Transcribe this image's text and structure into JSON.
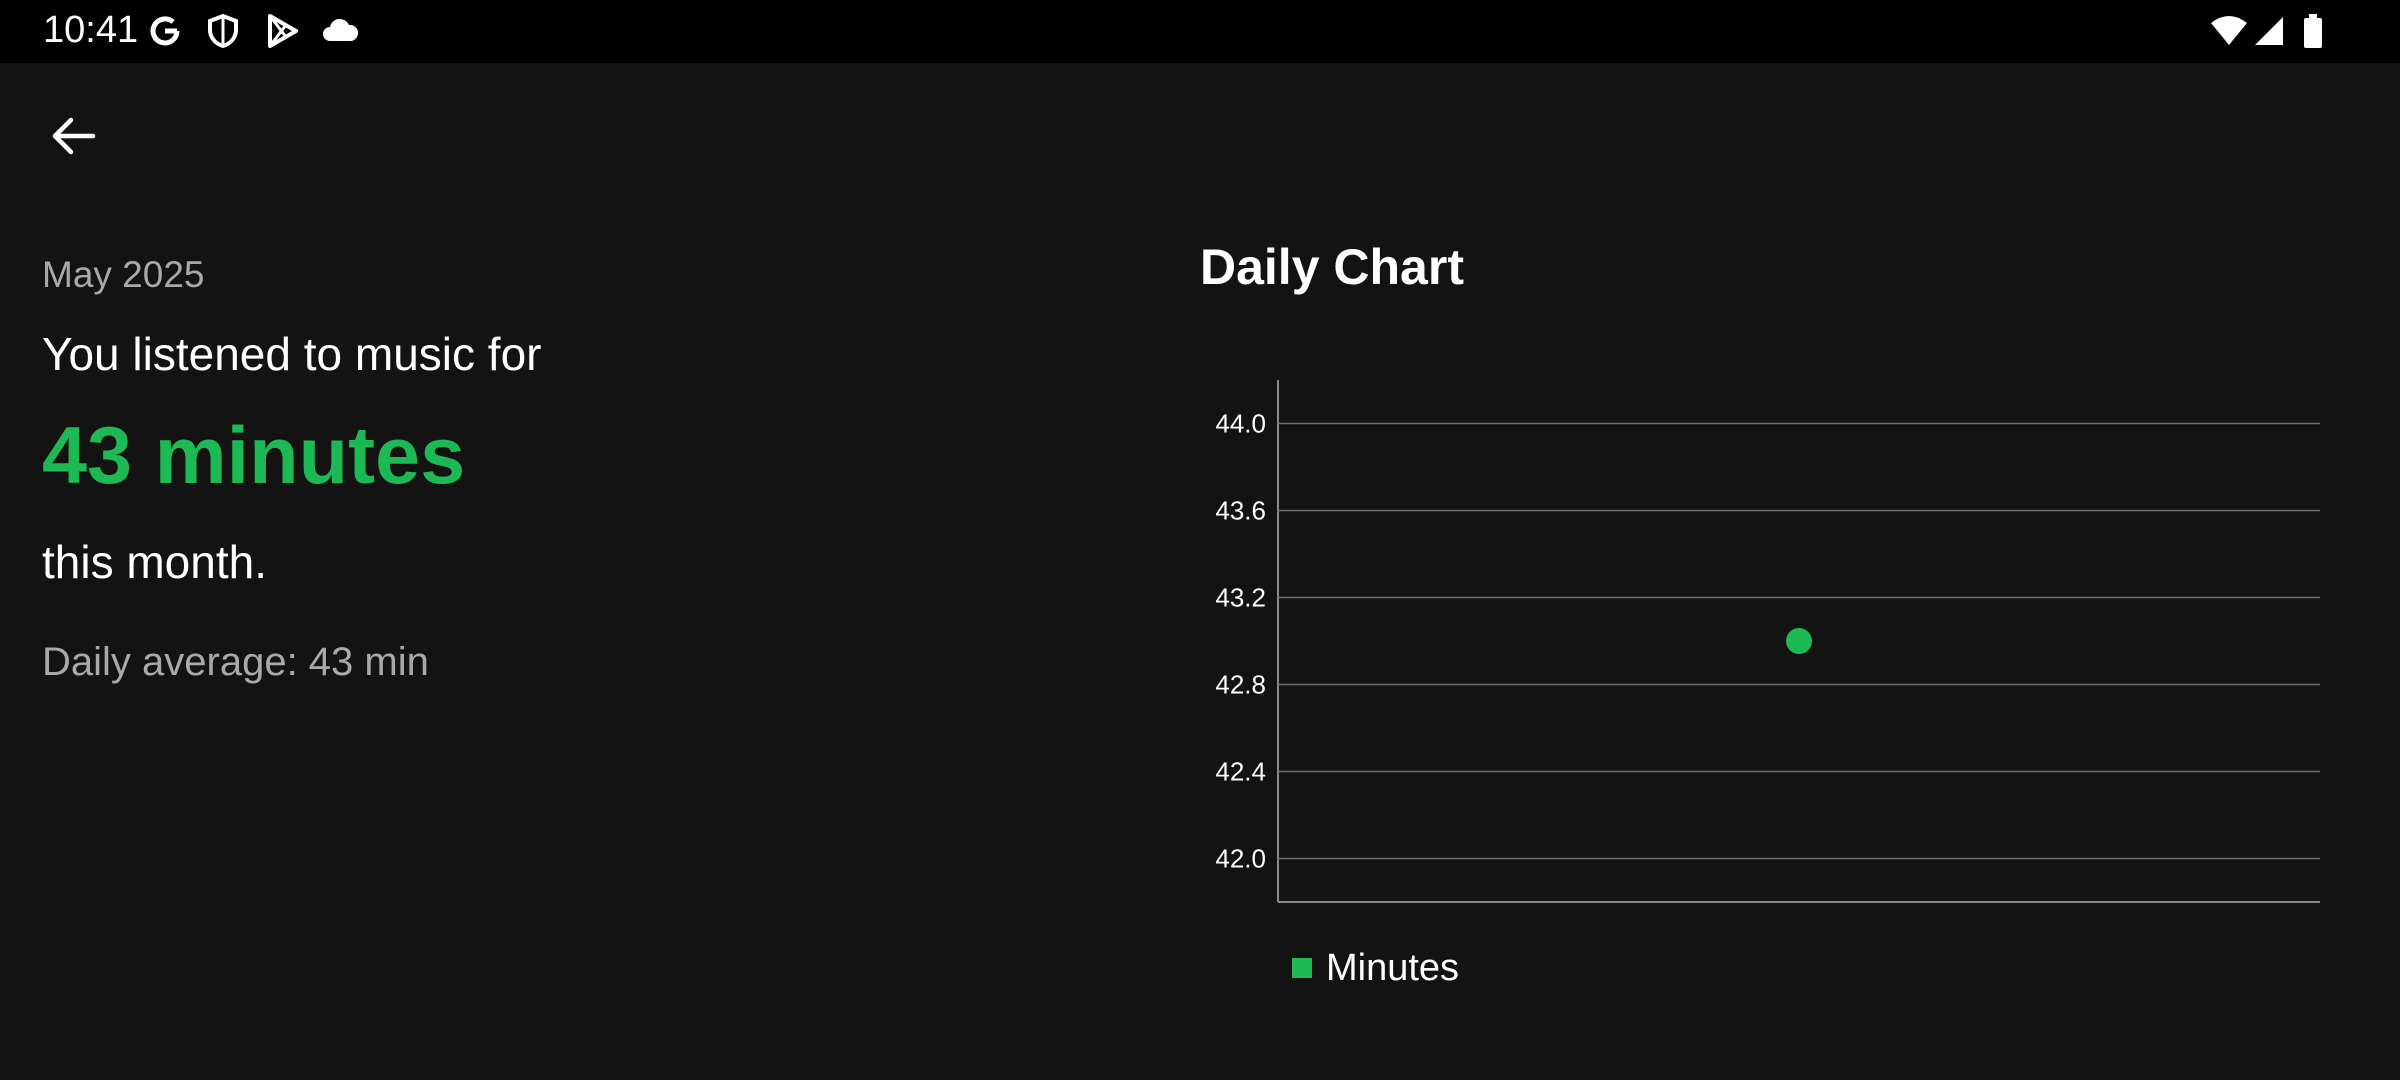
{
  "status_bar": {
    "time": "10:41",
    "left_icons": [
      "google-icon",
      "shield-icon",
      "play-store-icon",
      "cloud-icon"
    ],
    "right_icons": [
      "wifi-icon",
      "signal-icon",
      "battery-icon"
    ]
  },
  "toolbar": {
    "back_icon": "arrow-back-icon"
  },
  "summary": {
    "period": "May 2025",
    "intro": "You listened to music for",
    "total": "43 minutes",
    "outro": "this month.",
    "daily_average": "Daily average: 43 min"
  },
  "colors": {
    "accent": "#1DB954",
    "background": "#131313",
    "secondary_text": "#a9a9a9"
  },
  "chart": {
    "title": "Daily Chart",
    "legend": "Minutes"
  },
  "chart_data": {
    "type": "scatter",
    "title": "Daily Chart",
    "x": [
      1
    ],
    "series": [
      {
        "name": "Minutes",
        "values": [
          43.0
        ],
        "color": "#1DB954"
      }
    ],
    "ylim": [
      41.8,
      44.2
    ],
    "xlim": [
      0,
      2
    ],
    "yticks": [
      42.0,
      42.4,
      42.8,
      43.2,
      43.6,
      44.0
    ],
    "ytick_labels": [
      "42.0",
      "42.4",
      "42.8",
      "43.2",
      "43.6",
      "44.0"
    ],
    "grid": true,
    "legend_position": "bottom-left"
  }
}
